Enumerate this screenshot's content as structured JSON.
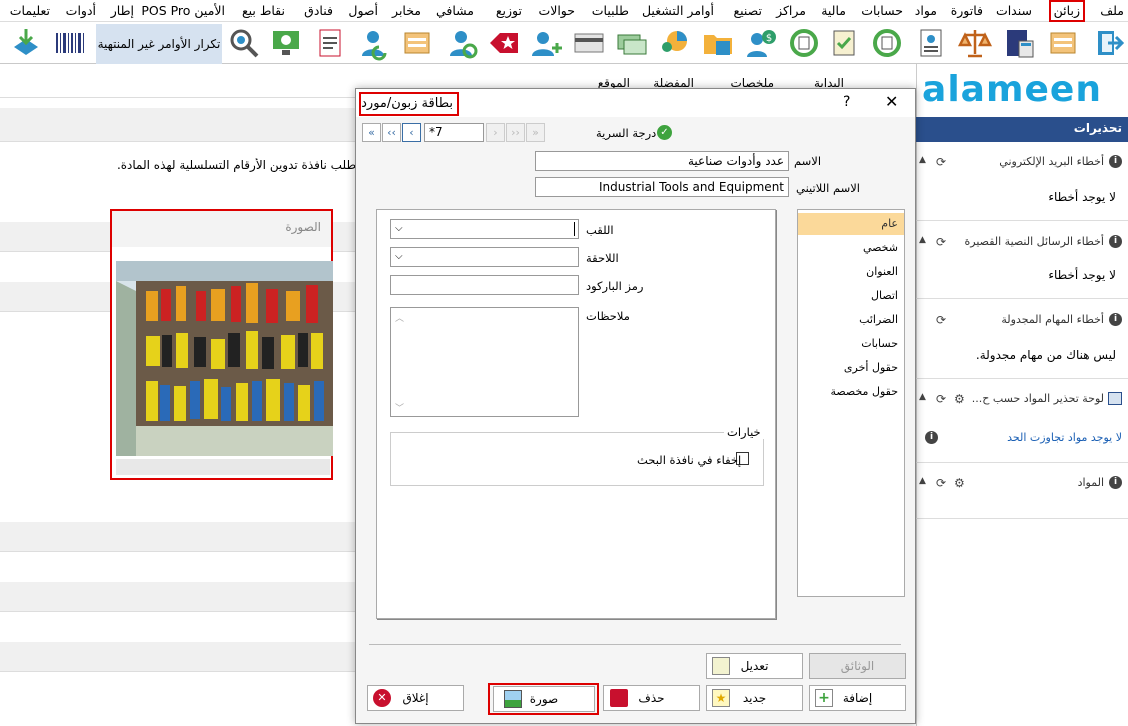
{
  "menu": [
    "ملف",
    "زبائن",
    "سندات",
    "فاتورة",
    "مواد",
    "حسابات",
    "مالية",
    "مراكز",
    "تصنيع",
    "أوامر التشغيل",
    "طلبيات",
    "حوالات",
    "توزيع",
    "مشافي",
    "مخابر",
    "أصول",
    "فنادق",
    "نقاط بيع",
    "الأمين POS Pro",
    "إطار",
    "أدوات",
    "تعليمات"
  ],
  "toolbar": {
    "repeat_label": "تكرار الأوامر غير المنتهية"
  },
  "tabs": {
    "start": "البداية",
    "summaries": "ملخصات",
    "favorites": "المفضلة",
    "location": "الموقع"
  },
  "left_pane": {
    "message": "طلب نافذة تدوين الأرقام التسلسلية لهذه المادة."
  },
  "image_panel": {
    "title": "الصورة"
  },
  "logo": {
    "text": "alameen"
  },
  "alerts": {
    "header": "تحذيرات",
    "sections": [
      {
        "title": "أخطاء البريد الإلكتروني",
        "body": "لا يوجد أخطاء"
      },
      {
        "title": "أخطاء الرسائل النصية القصيرة",
        "body": "لا يوجد أخطاء"
      },
      {
        "title": "أخطاء المهام المجدولة",
        "body": "ليس هناك من مهام مجدولة."
      },
      {
        "title": "لوحة تحذير المواد حسب ح...",
        "body": "لا يوجد مواد تجاوزت الحد"
      },
      {
        "title": "المواد",
        "body": ""
      }
    ]
  },
  "dialog": {
    "title": "بطاقة زبون/مورد",
    "help": "?",
    "close": "✕",
    "record_no": "*7",
    "privacy_label": "درجة السرية",
    "name_label": "الاسم",
    "name_value": "عدد وأدوات صناعية",
    "latin_label": "الاسم اللاتيني",
    "latin_value": "Industrial Tools and Equipment",
    "fields": {
      "title": "اللقب",
      "suffix": "اللاحقة",
      "barcode": "رمز الباركود",
      "notes": "ملاحظات"
    },
    "options_group": "خيارات",
    "hide_search": "إخفاء في نافذة البحث",
    "side_tabs": [
      "عام",
      "شخصي",
      "العنوان",
      "اتصال",
      "الضرائب",
      "حسابات",
      "حقول أخرى",
      "حقول مخصصة"
    ],
    "buttons": {
      "documents": "الوثائق",
      "edit": "تعديل",
      "add": "إضافة",
      "new": "جديد",
      "delete": "حذف",
      "image": "صورة",
      "close": "إغلاق"
    }
  }
}
